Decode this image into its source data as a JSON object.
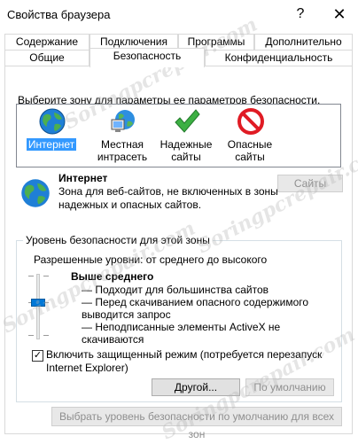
{
  "window": {
    "title": "Свойства браузера",
    "help_glyph": "?",
    "close_glyph": "✕"
  },
  "tabs": {
    "row1": [
      "Содержание",
      "Подключения",
      "Программы",
      "Дополнительно"
    ],
    "row2": [
      "Общие",
      "Безопасность",
      "Конфиденциальность"
    ],
    "active": "Безопасность"
  },
  "zones": {
    "prompt": "Выберите зону для параметры ее параметров безопасности.",
    "items": [
      {
        "label": "Интернет",
        "icon": "globe-icon",
        "selected": true
      },
      {
        "label": "Местная интрасеть",
        "icon": "intranet-icon",
        "selected": false
      },
      {
        "label": "Надежные сайты",
        "icon": "checkmark-icon",
        "selected": false
      },
      {
        "label": "Опасные сайты",
        "icon": "prohibited-icon",
        "selected": false
      }
    ]
  },
  "zone_info": {
    "title": "Интернет",
    "description": "Зона для веб-сайтов, не включенных в зоны надежных и опасных сайтов.",
    "sites_button": "Сайты"
  },
  "security_level": {
    "group_label": "Уровень безопасности для этой зоны",
    "allowed_levels": "Разрешенные уровни: от среднего до высокого",
    "level_name": "Выше среднего",
    "level_points": [
      "— Подходит для большинства сайтов",
      "— Перед скачиванием опасного содержимого выводится запрос",
      "— Неподписанные элементы ActiveX не скачиваются"
    ],
    "slider_level": "Выше среднего",
    "protected_mode_label": "Включить защищенный режим (потребуется перезапуск Internet Explorer)",
    "protected_mode_checked": true,
    "custom_button": "Другой...",
    "default_button": "По умолчанию",
    "all_zones_button": "Выбрать уровень безопасности по умолчанию для всех зон"
  },
  "watermark_text": "Soringpcrepair.com"
}
